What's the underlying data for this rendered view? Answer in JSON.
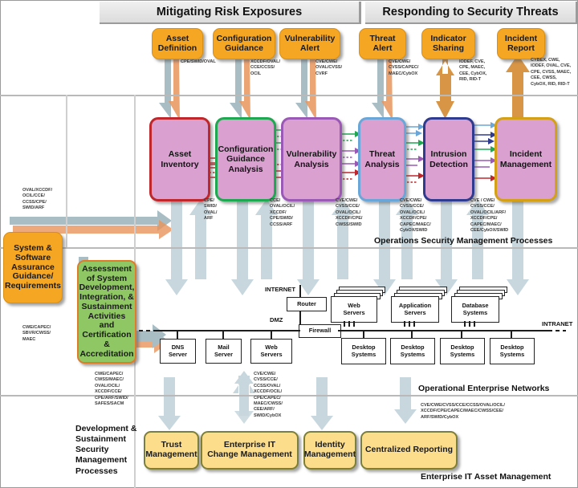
{
  "banners": {
    "left": "Mitigating Risk Exposures",
    "right": "Responding to Security Threats"
  },
  "top_boxes": [
    {
      "label": "Asset\nDefinition",
      "codes": "CPE/SWID/OVAL"
    },
    {
      "label": "Configuration\nGuidance",
      "codes": "XCCDF/OVAL/\nCCE/CCSS/\nOCIL"
    },
    {
      "label": "Vulnerability\nAlert",
      "codes": "CVE/CWE/\nOVAL/CVSS/\nCVRF"
    },
    {
      "label": "Threat\nAlert",
      "codes": "CVE/CWE/\nCVSS/CAPEC/\nMAEC/CybOX"
    },
    {
      "label": "Indicator\nSharing",
      "codes": "IODEF, CVE,\nCPE, MAEC,\nCEE, CybOX,\nRID, RID-T"
    },
    {
      "label": "Incident\nReport",
      "codes": "CYBEX, CWE,\nIODEF,  OVAL, CVE,\nCPE, CVSS, MAEC,\nCEE, CWSS,\nCybOX, RID, RID-T"
    }
  ],
  "process_boxes": [
    {
      "label": "Asset\nInventory",
      "border": "#c0272d",
      "codes": "CPE/\nSWID/\nOVAL/\nARF"
    },
    {
      "label": "Configuration\nGuidance\nAnalysis",
      "border": "#1fa851",
      "codes": "CCE/\nOVAL/OCIL/\nXCCDF/\nCPE/SWID/\nCCSS/ARF"
    },
    {
      "label": "Vulnerability\nAnalysis",
      "border": "#9b59b6",
      "codes": "CVE/CWE/\nCVSS/CCE/\nOVAL/OCIL/\nXCCDF/CPE/\nCWSS/SWID"
    },
    {
      "label": "Threat\nAnalysis",
      "border": "#6aa7d8",
      "codes": "CVE/CWE/\nCVSS/CCE/\nOVAL/OCIL/\nXCCDF/CPE/\nCAPEC/MAEC/\nCybOX/SWID"
    },
    {
      "label": "Intrusion\nDetection",
      "border": "#2e3b8f",
      "codes": "CVE / CWE/\nCVSS/CCE/\nOVAL/OCIL/ARF/\nXCCDF/CPE/\nCAPEC/MAEC/\nCEE/CybOX/SWID"
    },
    {
      "label": "Incident\nManagement",
      "border": "#d3a017",
      "codes": ""
    }
  ],
  "left_boxes": {
    "assurance": {
      "label": "System &\nSoftware\nAssurance\nGuidance/\nRequirements"
    },
    "assessment": {
      "label": "Assessment\nof System\nDevelopment,\nIntegration, &\nSustainment\nActivities\nand\nCertification &\nAccreditation"
    },
    "code_top": "OVAL/XCCDF/\nOCIL/CCE/\nCCSS/CPE/\nSWID/ARF",
    "code_mid": "CWE/CAPEC/\nSBVR/CWSS/\nMAEC",
    "code_bottom": "CWE/CAPEC/\nCWSS/MAEC/\nOVAL/OCIL/\nXCCDF/CCE/\nCPE/ARF/SWID/\nSAFES/SACM"
  },
  "lane_captions": {
    "operations": "Operations Security Management Processes",
    "networks": "Operational Enterprise Networks",
    "asset_mgmt": "Enterprise IT Asset Management",
    "dev_sustain": "Development &\nSustainment\nSecurity\nManagement\nProcesses"
  },
  "network": {
    "internet": "INTERNET",
    "dmz": "DMZ",
    "intranet": "INTRANET",
    "router": "Router",
    "firewall": "Firewall",
    "dmz_hosts": [
      {
        "label": "DNS\nServer"
      },
      {
        "label": "Mail\nServer"
      },
      {
        "label": "Web\nServers"
      }
    ],
    "server_stacks": [
      {
        "label": "Web\nServers"
      },
      {
        "label": "Application\nServers"
      },
      {
        "label": "Database\nSystems"
      }
    ],
    "desktops": [
      {
        "label": "Desktop\nSystems"
      },
      {
        "label": "Desktop\nSystems"
      },
      {
        "label": "Desktop\nSystems"
      },
      {
        "label": "Desktop\nSystems"
      }
    ],
    "code_dmz": "CVE/CWE/\nCVSS/CCE/\nCCSS/OVAL/\nXCCDF/OCIL/\nCPE/CAPEC/\nMAEC/CWSS/\nCEE/ARF/\nSWID/CybOX",
    "code_intranet": "CVE/CWE/CVSS/CCE/CCSS/OVAL/OCIL/\nXCCDF/CPE/CAPEC/MAEC/CWSS/CEE/\nARF/SWID/CybOX"
  },
  "bottom_boxes": [
    {
      "label": "Trust\nManagement"
    },
    {
      "label": "Enterprise IT\nChange Management"
    },
    {
      "label": "Identity\nManagement"
    },
    {
      "label": "Centralized Reporting"
    }
  ],
  "colors": {
    "orange": "#f5a623",
    "yellow": "#fbdd8c",
    "green": "#8fc765",
    "process_fill": "#d9a0d0",
    "grey_arrow": "#a8bdc4",
    "orange_arrow": "#e8945a",
    "banner_bg": "#e4e4e4"
  }
}
